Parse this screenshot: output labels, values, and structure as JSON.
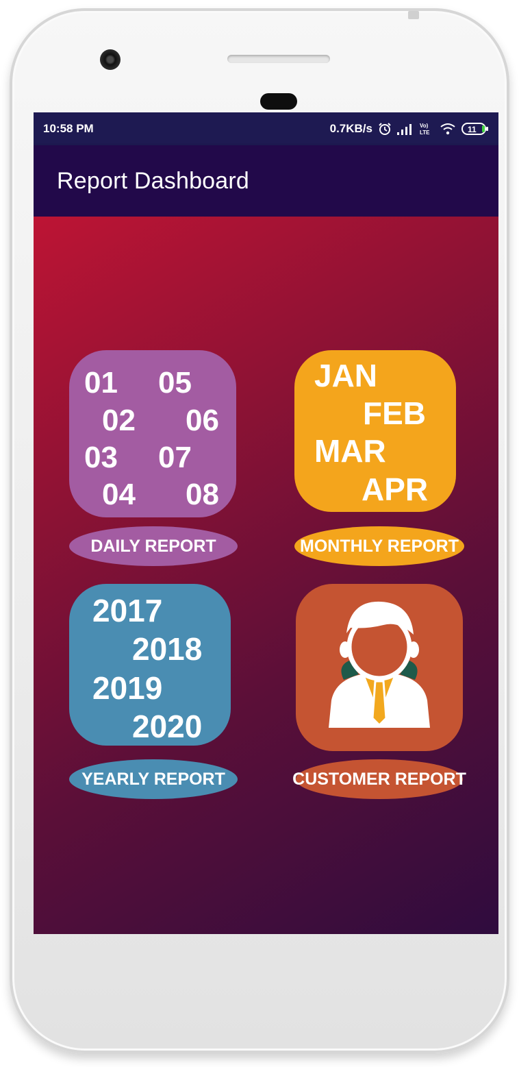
{
  "status_bar": {
    "time": "10:58 PM",
    "speed": "0.7KB/s",
    "battery": "11",
    "icons": [
      "alarm-icon",
      "signal-icon",
      "volte-icon",
      "wifi-icon",
      "battery-icon"
    ]
  },
  "app_bar": {
    "title": "Report Dashboard"
  },
  "tiles": {
    "daily": {
      "values": [
        "01",
        "05",
        "02",
        "06",
        "03",
        "07",
        "04",
        "08"
      ],
      "label": "DAILY REPORT",
      "color": "#a35ca2"
    },
    "monthly": {
      "values": [
        "JAN",
        "FEB",
        "MAR",
        "APR"
      ],
      "label": "MONTHLY REPORT",
      "color": "#f4a51c"
    },
    "yearly": {
      "values": [
        "2017",
        "2018",
        "2019",
        "2020"
      ],
      "label": "YEARLY REPORT",
      "color": "#4a8db2"
    },
    "customer": {
      "icon": "customer-person-icon",
      "label": "CUSTOMER REPORT",
      "color": "#c55432"
    }
  },
  "colors": {
    "status_bar": "#1e1a52",
    "app_bar": "#22094a",
    "background_top": "#bd1434",
    "background_bottom": "#2f0c3e"
  }
}
